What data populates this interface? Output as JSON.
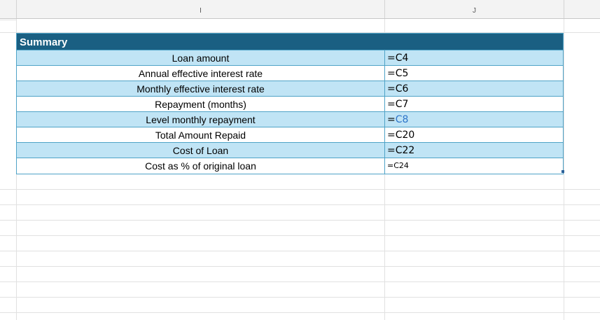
{
  "columns": {
    "i": "I",
    "j": "J"
  },
  "summary": {
    "title": "Summary",
    "rows": [
      {
        "label": "Loan amount",
        "value": "=C4"
      },
      {
        "label": "Annual effective interest rate",
        "value": "=C5"
      },
      {
        "label": "Monthly effective interest rate",
        "value": "=C6"
      },
      {
        "label": "Repayment (months)",
        "value": "=C7"
      },
      {
        "label": "Level monthly repayment",
        "value_prefix": "=",
        "value_ref": "C8"
      },
      {
        "label": "Total Amount Repaid",
        "value": "=C20"
      },
      {
        "label": "Cost of Loan",
        "value": "=C22"
      },
      {
        "label": "Cost as % of original loan",
        "value": "=C24"
      }
    ]
  },
  "colors": {
    "header_bg": "#1a5f82",
    "shaded_row": "#c0e4f5",
    "border": "#4fa3c7",
    "reference_text": "#2e75c9"
  }
}
